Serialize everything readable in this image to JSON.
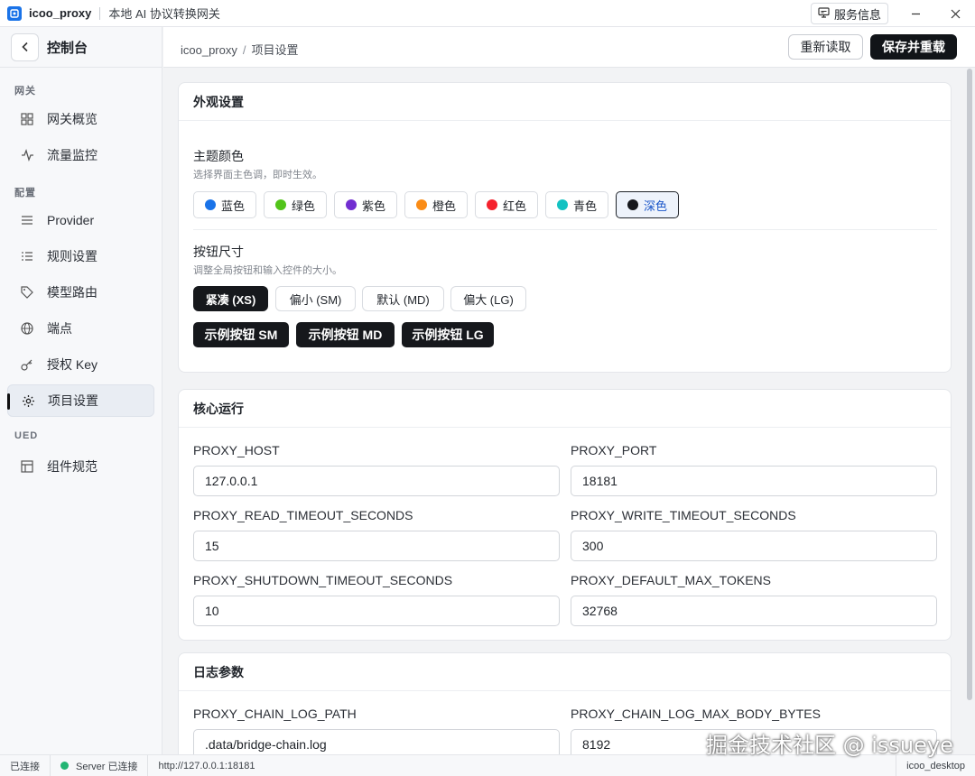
{
  "window": {
    "app_name": "icoo_proxy",
    "subtitle": "本地 AI 协议转换网关",
    "service_info_label": "服务信息",
    "minimize_icon": "minimize-icon",
    "close_icon": "close-icon"
  },
  "sidebar": {
    "title": "控制台",
    "groups": [
      {
        "label": "网关",
        "items": [
          {
            "label": "网关概览",
            "icon": "grid-icon"
          },
          {
            "label": "流量监控",
            "icon": "activity-icon"
          }
        ]
      },
      {
        "label": "配置",
        "items": [
          {
            "label": "Provider",
            "icon": "layers-icon"
          },
          {
            "label": "规则设置",
            "icon": "list-icon"
          },
          {
            "label": "模型路由",
            "icon": "tag-icon"
          },
          {
            "label": "端点",
            "icon": "globe-icon"
          },
          {
            "label": "授权 Key",
            "icon": "key-icon"
          },
          {
            "label": "项目设置",
            "icon": "gear-icon",
            "active": true
          }
        ]
      },
      {
        "label": "UED",
        "items": [
          {
            "label": "组件规范",
            "icon": "layout-icon"
          }
        ]
      }
    ]
  },
  "header": {
    "breadcrumb": [
      "icoo_proxy",
      "项目设置"
    ],
    "breadcrumb_sep": "/",
    "reload_label": "重新读取",
    "save_label": "保存并重载"
  },
  "appearance": {
    "title": "外观设置",
    "theme_title": "主题颜色",
    "theme_desc": "选择界面主色调，即时生效。",
    "colors": [
      {
        "label": "蓝色",
        "color": "#1a73e8"
      },
      {
        "label": "绿色",
        "color": "#52c41a"
      },
      {
        "label": "紫色",
        "color": "#722ed1"
      },
      {
        "label": "橙色",
        "color": "#fa8c16"
      },
      {
        "label": "红色",
        "color": "#f5222d"
      },
      {
        "label": "青色",
        "color": "#13c2c2"
      },
      {
        "label": "深色",
        "color": "#16181c",
        "selected": true
      }
    ],
    "size_title": "按钮尺寸",
    "size_desc": "调整全局按钮和输入控件的大小。",
    "sizes": [
      {
        "label": "紧凑 (XS)",
        "active": true
      },
      {
        "label": "偏小 (SM)"
      },
      {
        "label": "默认 (MD)"
      },
      {
        "label": "偏大 (LG)"
      }
    ],
    "demo_buttons": [
      "示例按钮 SM",
      "示例按钮 MD",
      "示例按钮 LG"
    ]
  },
  "core": {
    "title": "核心运行",
    "fields": [
      {
        "label": "PROXY_HOST",
        "value": "127.0.0.1"
      },
      {
        "label": "PROXY_PORT",
        "value": "18181"
      },
      {
        "label": "PROXY_READ_TIMEOUT_SECONDS",
        "value": "15"
      },
      {
        "label": "PROXY_WRITE_TIMEOUT_SECONDS",
        "value": "300"
      },
      {
        "label": "PROXY_SHUTDOWN_TIMEOUT_SECONDS",
        "value": "10"
      },
      {
        "label": "PROXY_DEFAULT_MAX_TOKENS",
        "value": "32768"
      }
    ]
  },
  "logs": {
    "title": "日志参数",
    "fields": [
      {
        "label": "PROXY_CHAIN_LOG_PATH",
        "value": ".data/bridge-chain.log"
      },
      {
        "label": "PROXY_CHAIN_LOG_MAX_BODY_BYTES",
        "value": "8192"
      }
    ]
  },
  "statusbar": {
    "connection": "已连接",
    "server_status": "Server 已连接",
    "url": "http://127.0.0.1:18181",
    "app_id": "icoo_desktop",
    "status_color": "#22b573"
  },
  "watermark": "掘金技术社区 @ issueye"
}
